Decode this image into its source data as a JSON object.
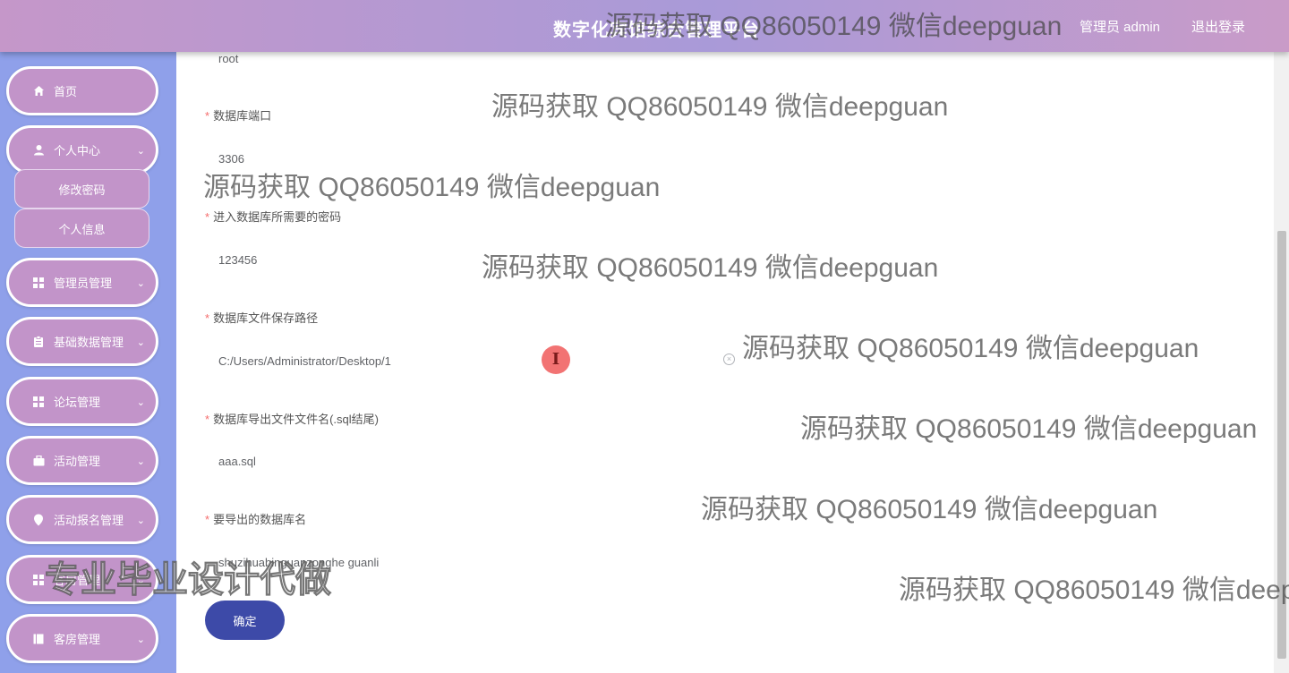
{
  "header": {
    "title": "数字化宾馆综合管理平台",
    "user_label": "管理员 admin",
    "logout_label": "退出登录"
  },
  "sidebar": {
    "items": [
      {
        "label": "首页",
        "icon": "home-icon"
      },
      {
        "label": "个人中心",
        "icon": "user-icon"
      },
      {
        "label": "管理员管理",
        "icon": "grid-icon"
      },
      {
        "label": "基础数据管理",
        "icon": "clipboard-icon"
      },
      {
        "label": "论坛管理",
        "icon": "grid-icon"
      },
      {
        "label": "活动管理",
        "icon": "briefcase-icon"
      },
      {
        "label": "活动报名管理",
        "icon": "pin-icon"
      },
      {
        "label": "客房管理",
        "icon": "grid-icon"
      },
      {
        "label": "客房管理",
        "icon": "book-icon"
      }
    ],
    "sub_items": [
      {
        "label": "修改密码"
      },
      {
        "label": "个人信息"
      }
    ]
  },
  "form": {
    "fields": [
      {
        "label": "",
        "value": "root"
      },
      {
        "label": "数据库端口",
        "value": "3306"
      },
      {
        "label": "进入数据库所需要的密码",
        "value": "123456"
      },
      {
        "label": "数据库文件保存路径",
        "value": "C:/Users/Administrator/Desktop/1"
      },
      {
        "label": "数据库导出文件文件名(.sql结尾)",
        "value": "aaa.sql"
      },
      {
        "label": "要导出的数据库名",
        "value": "shuzihuabinguanzonghe guanli"
      }
    ],
    "required_mark": "*",
    "clear_icon": "⊗",
    "confirm_label": "确定"
  },
  "cursor_glyph": "I",
  "watermarks": {
    "line": "源码获取 QQ86050149 微信deepguan",
    "big": "专业毕业设计代做"
  }
}
